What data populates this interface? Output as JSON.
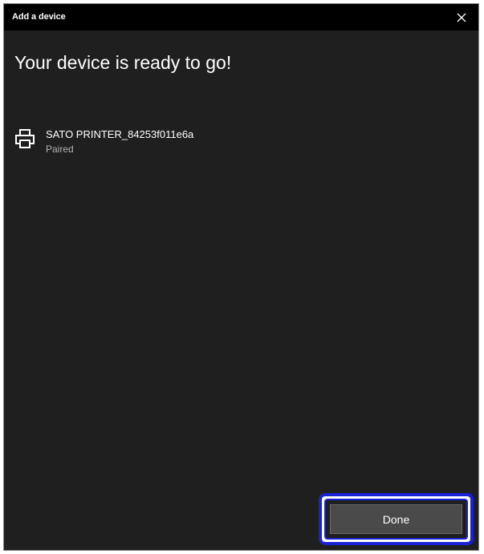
{
  "window": {
    "title": "Add a device",
    "close_icon": "close-icon"
  },
  "main": {
    "heading": "Your device is ready to go!"
  },
  "device": {
    "icon": "printer-icon",
    "name": "SATO PRINTER_84253f011e6a",
    "status": "Paired"
  },
  "footer": {
    "done_label": "Done"
  },
  "colors": {
    "window_bg": "#1f1f1f",
    "titlebar_bg": "#000000",
    "button_bg": "#4a4a4a",
    "focus_highlight": "#1a22d6"
  }
}
